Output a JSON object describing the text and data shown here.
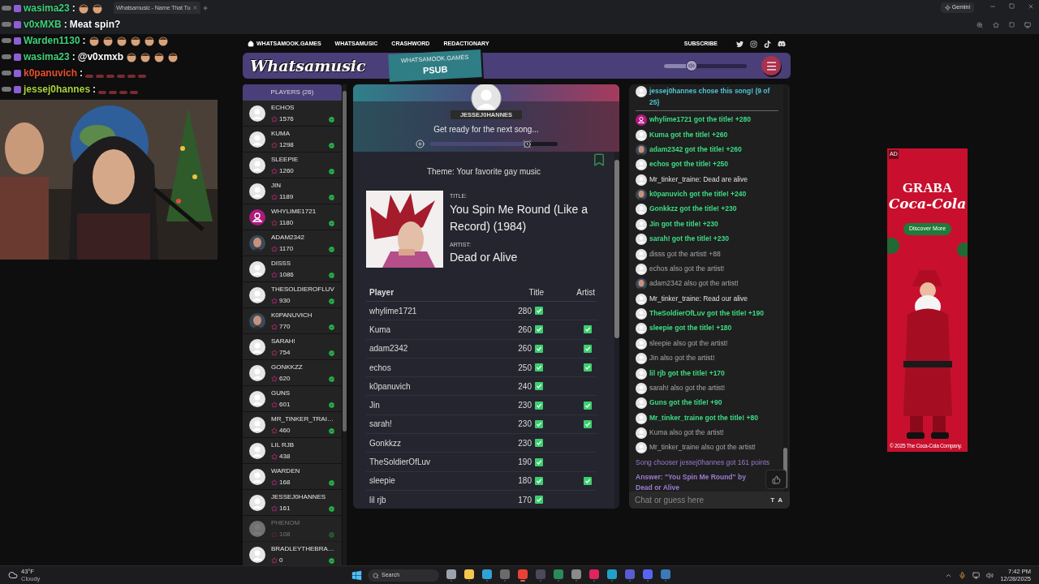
{
  "browser": {
    "tab_title": "Whatsamusic - Name That Tu",
    "gemini": "Gemini"
  },
  "stream_chat": [
    {
      "user": "wasima23",
      "color": "#3fd07a",
      "separator": ":",
      "emotes": [
        {
          "kind": "face"
        },
        {
          "kind": "face"
        }
      ]
    },
    {
      "user": "v0xMXB",
      "color": "#3fd07a",
      "separator": ":",
      "message": "Meat spin?"
    },
    {
      "user": "Warden1130",
      "color": "#3fd07a",
      "separator": ":",
      "emotes": [
        {
          "kind": "face"
        },
        {
          "kind": "face"
        },
        {
          "kind": "face"
        },
        {
          "kind": "face"
        },
        {
          "kind": "face"
        },
        {
          "kind": "face"
        }
      ]
    },
    {
      "user": "wasima23",
      "color": "#3fd07a",
      "separator": ":",
      "message": "@v0xmxb",
      "emotes": [
        {
          "kind": "face"
        },
        {
          "kind": "face"
        },
        {
          "kind": "face"
        },
        {
          "kind": "face"
        }
      ]
    },
    {
      "user": "k0panuvich",
      "color": "#e8502e",
      "separator": ":",
      "emotes": [
        {
          "kind": "mark"
        },
        {
          "kind": "mark"
        },
        {
          "kind": "mark"
        },
        {
          "kind": "mark"
        },
        {
          "kind": "mark"
        },
        {
          "kind": "mark"
        }
      ]
    },
    {
      "user": "jessej0hannes",
      "color": "#a9d23c",
      "separator": ":",
      "emotes": [
        {
          "kind": "mark"
        },
        {
          "kind": "mark"
        },
        {
          "kind": "mark"
        },
        {
          "kind": "mark"
        }
      ]
    }
  ],
  "nav": {
    "links": [
      "WHATSAMOOK.GAMES",
      "WHATSAMUSIC",
      "CRASHWORD",
      "REDACTIONARY"
    ],
    "subscribe": "SUBSCRIBE"
  },
  "header": {
    "logo": "Whatsamusic",
    "tag_site": "WHATSAMOOK.GAMES",
    "tag_room": "PSUB",
    "volume": {
      "level": 0.33
    }
  },
  "players": {
    "title": "PLAYERS (26)",
    "items": [
      {
        "name": "ECHOS",
        "score": "1576",
        "avatar": {
          "kind": "default"
        },
        "ready": true,
        "away": false
      },
      {
        "name": "KUMA",
        "score": "1298",
        "avatar": {
          "kind": "default"
        },
        "ready": true,
        "away": false
      },
      {
        "name": "SLEEPIE",
        "score": "1260",
        "avatar": {
          "kind": "default"
        },
        "ready": true,
        "away": false
      },
      {
        "name": "JIN",
        "score": "1189",
        "avatar": {
          "kind": "default"
        },
        "ready": true,
        "away": false
      },
      {
        "name": "WHYLIME1721",
        "score": "1180",
        "avatar": {
          "kind": "user-icon"
        },
        "ready": true,
        "away": false
      },
      {
        "name": "ADAM2342",
        "score": "1170",
        "ready": true,
        "away": false
      },
      {
        "name": "DISSS",
        "score": "1086",
        "avatar": {
          "kind": "default"
        },
        "ready": true,
        "away": false
      },
      {
        "name": "THESOLDIEROFLUV",
        "score": "930",
        "avatar": {
          "kind": "default"
        },
        "ready": true,
        "away": false
      },
      {
        "name": "K0PANUVICH",
        "score": "770",
        "ready": true,
        "away": false
      },
      {
        "name": "SARAH!",
        "score": "754",
        "avatar": {
          "kind": "default"
        },
        "ready": true,
        "away": false
      },
      {
        "name": "GONKKZZ",
        "score": "620",
        "avatar": {
          "kind": "default"
        },
        "ready": true,
        "away": false
      },
      {
        "name": "GUNS",
        "score": "601",
        "avatar": {
          "kind": "default"
        },
        "ready": true,
        "away": false
      },
      {
        "name": "MR_TINKER_TRAI…",
        "score": "460",
        "avatar": {
          "kind": "default"
        },
        "ready": true,
        "away": false
      },
      {
        "name": "LIL RJB",
        "score": "438",
        "avatar": {
          "kind": "default"
        },
        "ready": false,
        "away": false
      },
      {
        "name": "WARDEN",
        "score": "168",
        "avatar": {
          "kind": "default"
        },
        "ready": true,
        "away": false
      },
      {
        "name": "JESSEJ0HANNES",
        "score": "161",
        "avatar": {
          "kind": "default"
        },
        "ready": true,
        "away": false
      },
      {
        "name": "PHENOM",
        "score": "108",
        "avatar": {
          "kind": "default"
        },
        "ready": true,
        "away": true
      },
      {
        "name": "BRADLEYTHEBRA…",
        "score": "0",
        "avatar": {
          "kind": "default"
        },
        "ready": true,
        "away": false
      }
    ]
  },
  "round": {
    "chooser": "JESSEJ0HANNES",
    "status": "Get ready for the next song...",
    "progress": {
      "level": 0.76
    },
    "theme": "Theme: Your favorite gay music",
    "title_label": "TITLE:",
    "title": "You Spin Me Round (Like a Record) (1984)",
    "artist_label": "ARTIST:",
    "artist": "Dead or Alive"
  },
  "results": {
    "columns": [
      "Player",
      "Title",
      "Artist"
    ],
    "rows": [
      {
        "player": "whylime1721",
        "title_points": "280",
        "title_correct": true,
        "artist_correct": false
      },
      {
        "player": "Kuma",
        "title_points": "260",
        "title_correct": true,
        "artist_correct": true
      },
      {
        "player": "adam2342",
        "title_points": "260",
        "title_correct": true,
        "artist_correct": true
      },
      {
        "player": "echos",
        "title_points": "250",
        "title_correct": true,
        "artist_correct": true
      },
      {
        "player": "k0panuvich",
        "title_points": "240",
        "title_correct": true,
        "artist_correct": false
      },
      {
        "player": "Jin",
        "title_points": "230",
        "title_correct": true,
        "artist_correct": true
      },
      {
        "player": "sarah!",
        "title_points": "230",
        "title_correct": true,
        "artist_correct": true
      },
      {
        "player": "Gonkkzz",
        "title_points": "230",
        "title_correct": true,
        "artist_correct": false
      },
      {
        "player": "TheSoldierOfLuv",
        "title_points": "190",
        "title_correct": true,
        "artist_correct": false
      },
      {
        "player": "sleepie",
        "title_points": "180",
        "title_correct": true,
        "artist_correct": true
      },
      {
        "player": "lil rjb",
        "title_points": "170",
        "title_correct": true,
        "artist_correct": false
      }
    ]
  },
  "chat": {
    "messages": [
      {
        "kind": "announce",
        "avatar": {
          "kind": "default"
        },
        "text": "jessej0hannes chose this song! (9 of 25)"
      },
      {
        "kind": "title",
        "avatar": {
          "kind": "user-icon"
        },
        "text": "whylime1721 got the title! +280"
      },
      {
        "kind": "title",
        "avatar": {
          "kind": "default"
        },
        "text": "Kuma got the title! +260"
      },
      {
        "kind": "title",
        "text": "adam2342 got the title! +260"
      },
      {
        "kind": "title",
        "avatar": {
          "kind": "default"
        },
        "text": "echos got the title! +250"
      },
      {
        "kind": "chat",
        "avatar": {
          "kind": "default"
        },
        "text": "Mr_tinker_traine: Dead are alive"
      },
      {
        "kind": "title",
        "text": "k0panuvich got the title! +240"
      },
      {
        "kind": "title",
        "avatar": {
          "kind": "default"
        },
        "text": "Gonkkzz got the title! +230"
      },
      {
        "kind": "title",
        "avatar": {
          "kind": "default"
        },
        "text": "Jin got the title! +230"
      },
      {
        "kind": "title",
        "avatar": {
          "kind": "default"
        },
        "text": "sarah! got the title! +230"
      },
      {
        "kind": "artist",
        "avatar": {
          "kind": "default"
        },
        "text": "disss got the artist! +88"
      },
      {
        "kind": "artist",
        "avatar": {
          "kind": "default"
        },
        "text": "echos also got the artist!"
      },
      {
        "kind": "artist",
        "text": "adam2342 also got the artist!"
      },
      {
        "kind": "chat",
        "avatar": {
          "kind": "default"
        },
        "text": "Mr_tinker_traine: Read our alive"
      },
      {
        "kind": "title",
        "avatar": {
          "kind": "default"
        },
        "text": "TheSoldierOfLuv got the title! +190"
      },
      {
        "kind": "title",
        "avatar": {
          "kind": "default"
        },
        "text": "sleepie got the title! +180"
      },
      {
        "kind": "artist",
        "avatar": {
          "kind": "default"
        },
        "text": "sleepie also got the artist!"
      },
      {
        "kind": "artist",
        "avatar": {
          "kind": "default"
        },
        "text": "Jin also got the artist!"
      },
      {
        "kind": "title",
        "avatar": {
          "kind": "default"
        },
        "text": "lil rjb got the title! +170"
      },
      {
        "kind": "artist",
        "avatar": {
          "kind": "default"
        },
        "text": "sarah! also got the artist!"
      },
      {
        "kind": "title",
        "avatar": {
          "kind": "default"
        },
        "text": "Guns got the title! +90"
      },
      {
        "kind": "title",
        "avatar": {
          "kind": "default"
        },
        "text": "Mr_tinker_traine got the title! +80"
      },
      {
        "kind": "artist",
        "avatar": {
          "kind": "default"
        },
        "text": "Kuma also got the artist!"
      },
      {
        "kind": "artist",
        "avatar": {
          "kind": "default"
        },
        "text": "Mr_tinker_traine also got the artist!"
      },
      {
        "kind": "system",
        "text": "Song chooser jessej0hannes got 161 points"
      },
      {
        "kind": "answer",
        "text": "Answer: \"You Spin Me Round\" by Dead or Alive"
      }
    ],
    "placeholder": "Chat or guess here",
    "modes": [
      "T",
      "A"
    ]
  },
  "ad": {
    "badge": "AD",
    "headline": "GRABA",
    "brand": "Coca-Cola",
    "cta": "Discover More",
    "footer": "© 2025 The Coca-Cola Company."
  },
  "taskbar": {
    "temperature": "43°F",
    "condition": "Cloudy",
    "search": "Search",
    "apps": [
      {
        "color": "#9aa3ad",
        "selected": false
      },
      {
        "color": "#f2c94c",
        "selected": false
      },
      {
        "color": "#2fa3d8",
        "selected": false
      },
      {
        "color": "#6b6b6b",
        "selected": false
      },
      {
        "color": "#e94235",
        "selected": true
      },
      {
        "color": "#4a4a5a",
        "selected": false
      },
      {
        "color": "#2b8a5a",
        "selected": false
      },
      {
        "color": "#8a8a8a",
        "selected": false
      },
      {
        "color": "#e0245e",
        "selected": false
      },
      {
        "color": "#22a0c8",
        "selected": false
      },
      {
        "color": "#5b5bd6",
        "selected": false
      },
      {
        "color": "#5865f2",
        "selected": false
      },
      {
        "color": "#3a7ab8",
        "selected": false
      }
    ],
    "time": "7:42 PM",
    "date": "12/28/2025"
  }
}
